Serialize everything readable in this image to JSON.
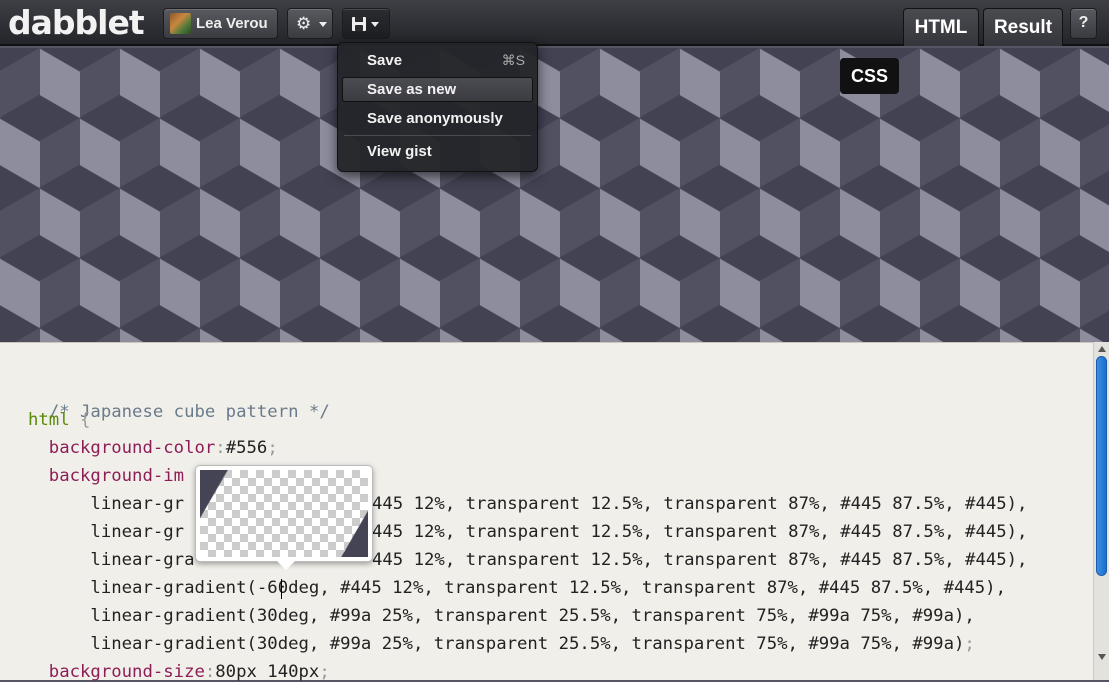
{
  "app": {
    "logo": "dabblet"
  },
  "toolbar": {
    "user_name": "Lea Verou",
    "help_label": "?"
  },
  "tabs": {
    "html": "HTML",
    "result": "Result",
    "css": "CSS"
  },
  "save_menu": {
    "items": [
      {
        "label": "Save",
        "shortcut": "⌘S"
      },
      {
        "label": "Save as new",
        "highlighted": true
      },
      {
        "label": "Save anonymously"
      },
      {
        "label": "View gist"
      }
    ]
  },
  "editor": {
    "lines": {
      "l1": "/* Japanese cube pattern */",
      "l2_sel": "html",
      "l2_brace": " {",
      "l3_prop": "  background-color",
      "l3_colon": ":",
      "l3_val": "#556",
      "l3_semi": ";",
      "l4_prop": "  background-im",
      "l5": "445 12%, transparent 12.5%, transparent 87%, #445 87.5%, #445),",
      "l5_start": "      linear-gr",
      "l6_start": "      linear-gr",
      "l6": "445 12%, transparent 12.5%, transparent 87%, #445 87.5%, #445),",
      "l7_start": "      linear-gra",
      "l7": "445 12%, transparent 12.5%, transparent 87%, #445 87.5%, #445),",
      "l8": "      linear-gradient(-60deg, #445 12%, transparent 12.5%, transparent 87%, #445 87.5%, #445),",
      "l9": "      linear-gradient(30deg, #99a 25%, transparent 25.5%, transparent 75%, #99a 75%, #99a),",
      "l10": "      linear-gradient(30deg, #99a 25%, transparent 25.5%, transparent 75%, #99a 75%, #99a)",
      "l10_semi": ";",
      "l11_prop": "  background-size",
      "l11_colon": ":",
      "l11_val": "80px 140px",
      "l11_semi": ";"
    }
  },
  "colors": {
    "dark_cube": "#445",
    "light_cube": "#99a",
    "base": "#556",
    "accent_scroll": "#2a7fd8"
  }
}
